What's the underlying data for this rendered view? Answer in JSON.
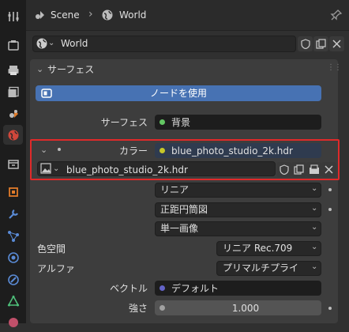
{
  "breadcrumb": {
    "scene": "Scene",
    "world": "World"
  },
  "world_field": {
    "value": "World"
  },
  "panel": {
    "title": "サーフェス",
    "use_nodes_button": "ノードを使用",
    "surface_label": "サーフェス",
    "surface_value": "背景",
    "color_label": "カラー",
    "color_value": "blue_photo_studio_2k.hdr",
    "image_name": "blue_photo_studio_2k.hdr",
    "interpolation": "リニア",
    "projection": "正距円筒図",
    "source": "単一画像",
    "color_space_label": "色空間",
    "color_space_value": "リニア Rec.709",
    "alpha_label": "アルファ",
    "alpha_value": "プリマルチプライ",
    "vector_label": "ベクトル",
    "vector_value": "デフォルト",
    "strength_label": "強さ",
    "strength_value": "1.000"
  },
  "colors": {
    "accent_blue": "#4772b3",
    "highlight_red": "#e02a2a",
    "socket_green": "#63c763",
    "socket_yellow": "#c7c729",
    "socket_purple": "#6363c7",
    "socket_gray": "#a1a1a1"
  }
}
